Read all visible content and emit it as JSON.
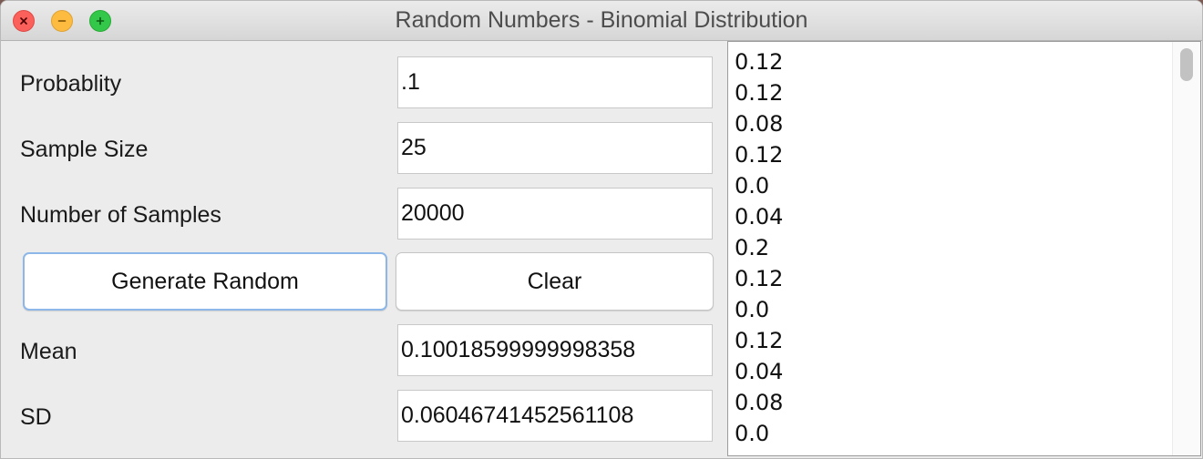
{
  "window": {
    "title": "Random Numbers - Binomial Distribution"
  },
  "form": {
    "probability_label": "Probablity",
    "probability_value": ".1",
    "sample_size_label": "Sample Size",
    "sample_size_value": "25",
    "num_samples_label": "Number of Samples",
    "num_samples_value": "20000",
    "mean_label": "Mean",
    "mean_value": "0.10018599999998358",
    "sd_label": "SD",
    "sd_value": "0.06046741452561108"
  },
  "buttons": {
    "generate_label": "Generate Random",
    "clear_label": "Clear"
  },
  "results": {
    "items": [
      "0.12",
      "0.12",
      "0.08",
      "0.12",
      "0.0",
      "0.04",
      "0.2",
      "0.12",
      "0.0",
      "0.12",
      "0.04",
      "0.08",
      "0.0"
    ]
  },
  "colors": {
    "close": "#fc605b",
    "minimize": "#fdbc40",
    "maximize": "#34c84a",
    "focus_ring": "#8db7e8"
  }
}
